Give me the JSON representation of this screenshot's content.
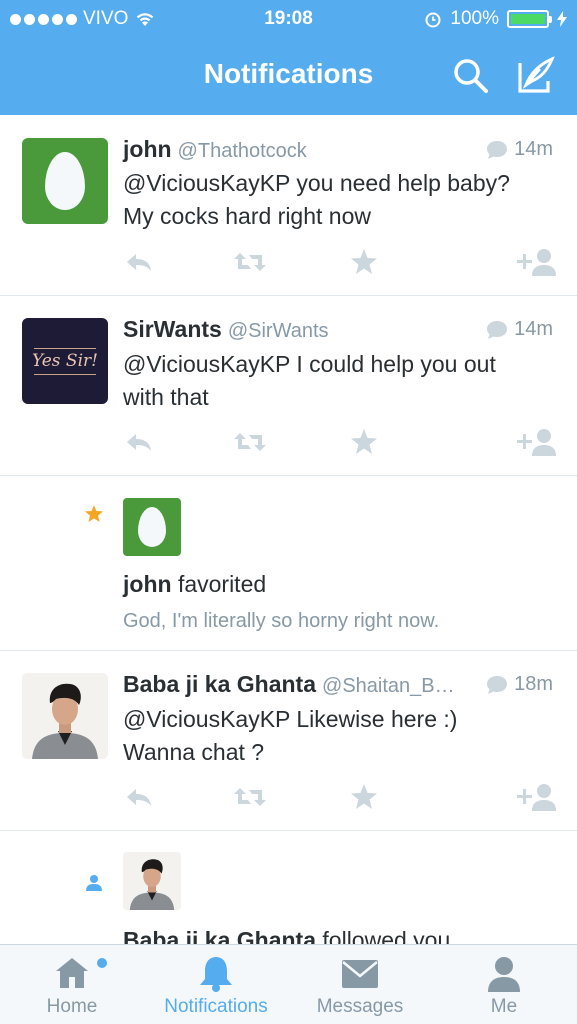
{
  "status_bar": {
    "carrier": "VIVO",
    "time": "19:08",
    "battery": "100%"
  },
  "header": {
    "title": "Notifications",
    "search_icon": "search-icon",
    "compose_icon": "compose-tweet-icon"
  },
  "notifications": [
    {
      "type": "mention",
      "name": "john",
      "handle": "@Thathotcock",
      "time": "14m",
      "text_lines": [
        "@ViciousKayKP you need help baby?",
        "My cocks hard right now"
      ]
    },
    {
      "type": "mention",
      "name": "SirWants",
      "handle": "@SirWants",
      "time": "14m",
      "avatar_text": "Yes Sir!",
      "text_lines": [
        "@ViciousKayKP I could help you out",
        "with that"
      ]
    },
    {
      "type": "favorite",
      "name": "john",
      "action": "favorited",
      "tweet": "God, I'm literally so horny right now."
    },
    {
      "type": "mention",
      "name": "Baba ji ka Ghanta",
      "handle": "@Shaitan_B…",
      "time": "18m",
      "text_lines": [
        "@ViciousKayKP Likewise here :)",
        "Wanna chat ?"
      ]
    },
    {
      "type": "follow",
      "name": "Baba ji ka Ghanta",
      "action": "followed you"
    }
  ],
  "tabbar": {
    "tabs": [
      {
        "label": "Home",
        "icon": "home-icon"
      },
      {
        "label": "Notifications",
        "icon": "bell-icon",
        "active": true
      },
      {
        "label": "Messages",
        "icon": "envelope-icon"
      },
      {
        "label": "Me",
        "icon": "person-icon"
      }
    ]
  },
  "colors": {
    "brand": "#55acee",
    "text": "#292f33",
    "muted": "#8899a6",
    "favorite_star": "#f5a623",
    "battery": "#4cd964"
  }
}
